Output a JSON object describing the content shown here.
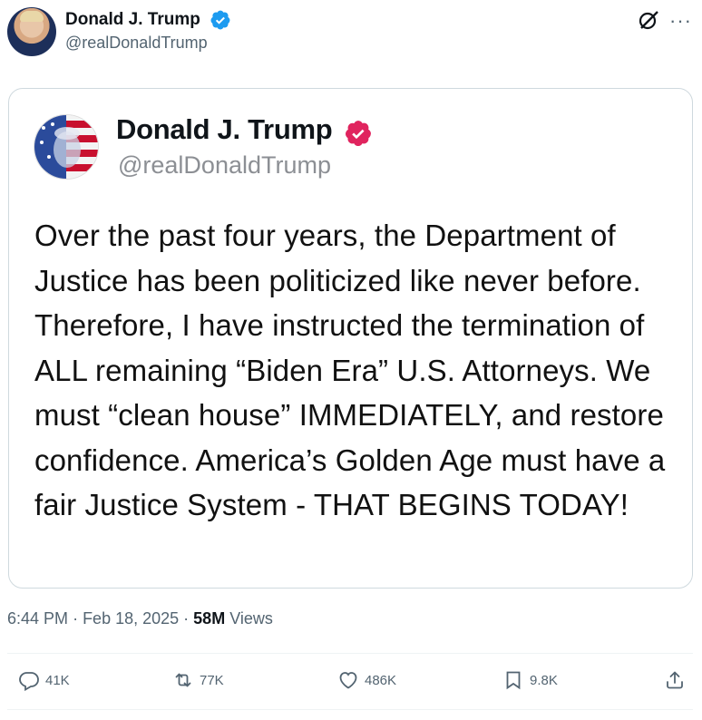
{
  "header": {
    "name": "Donald J. Trump",
    "handle": "@realDonaldTrump"
  },
  "card": {
    "name": "Donald J. Trump",
    "handle": "@realDonaldTrump",
    "text": "Over the past four years, the Department of Justice has been politicized like never before. Therefore, I have instructed the termination of ALL remaining “Biden Era” U.S. Attorneys. We must “clean house” IMMEDIATELY, and restore confidence. America’s Golden Age must have a fair Justice System - THAT BEGINS TODAY!"
  },
  "meta": {
    "time": "6:44 PM",
    "date": "Feb 18, 2025",
    "views_count": "58M",
    "views_label": "Views"
  },
  "actions": {
    "replies": "41K",
    "reposts": "77K",
    "likes": "486K",
    "bookmarks": "9.8K"
  },
  "icons": {
    "verified": "verified-badge-icon",
    "grok": "grok-icon",
    "more": "more-icon",
    "reply": "reply-icon",
    "repost": "repost-icon",
    "like": "heart-icon",
    "bookmark": "bookmark-icon",
    "share": "share-icon"
  },
  "colors": {
    "verified_header": "#1d9bf0",
    "verified_card": "#e0245e",
    "secondary_text": "#536471"
  }
}
